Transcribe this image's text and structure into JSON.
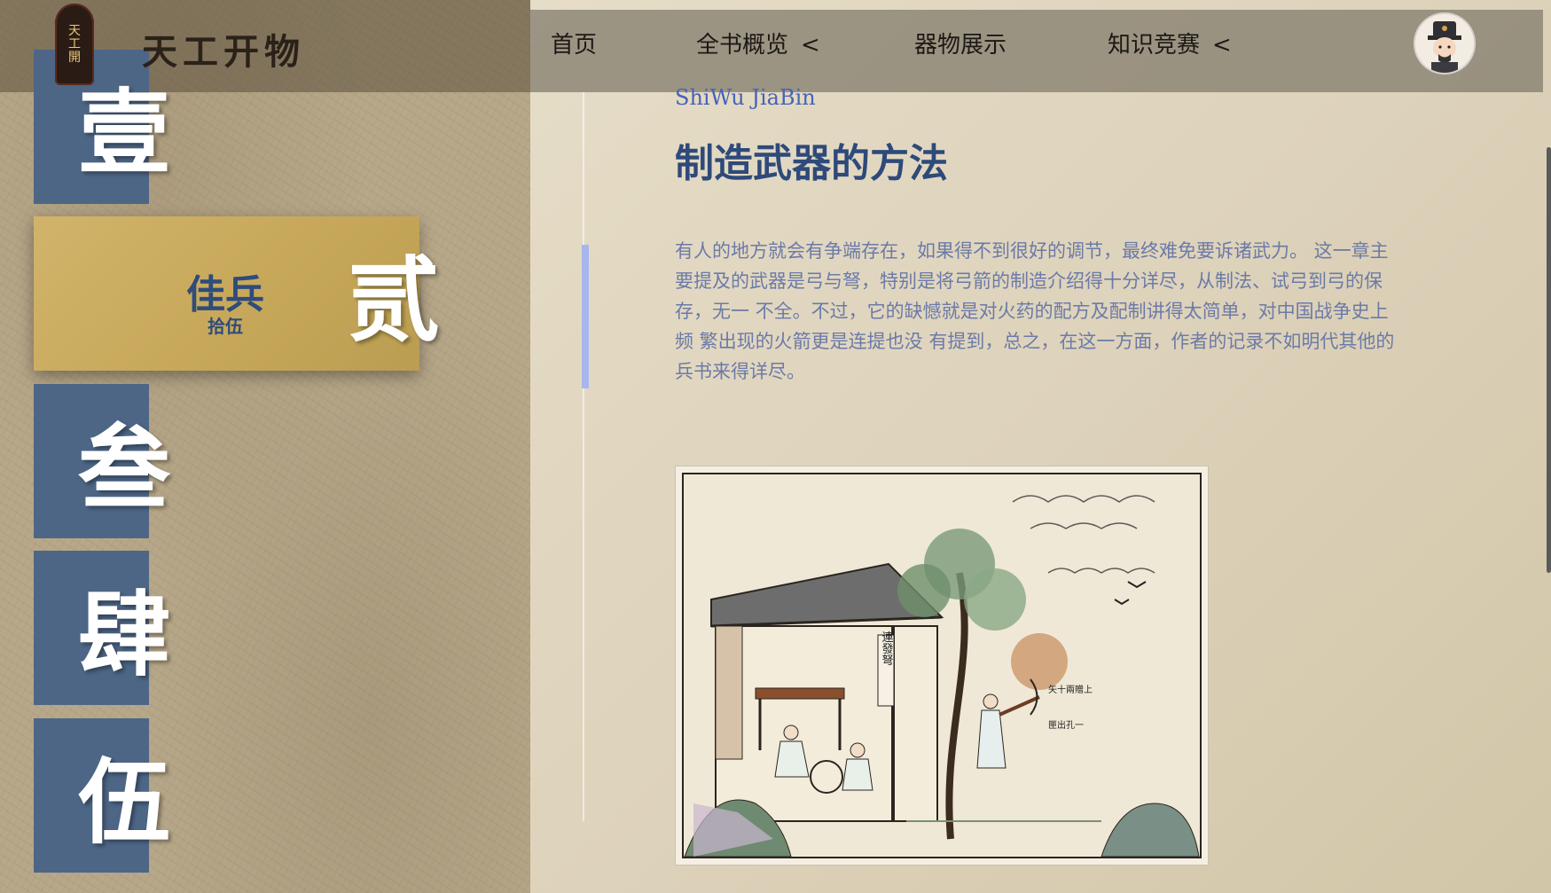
{
  "site": {
    "title": "天工开物",
    "seal_lines": [
      "天",
      "工",
      "開"
    ]
  },
  "nav": {
    "items": [
      {
        "label": "首页",
        "chevron": ""
      },
      {
        "label": "全书概览",
        "chevron": "<"
      },
      {
        "label": "器物展示",
        "chevron": ""
      },
      {
        "label": "知识竞赛",
        "chevron": "<"
      }
    ]
  },
  "avatar": {
    "icon": "scholar-avatar-icon"
  },
  "chapters": {
    "items": [
      {
        "char": "壹"
      },
      {
        "char": "贰"
      },
      {
        "char": "叁"
      },
      {
        "char": "肆"
      },
      {
        "char": "伍"
      }
    ],
    "active": {
      "title": "佳兵",
      "sub": "拾伍"
    }
  },
  "content": {
    "subtitle_en": "ShiWu JiaBin",
    "title": "制造武器的方法",
    "paragraph": "有人的地方就会有争端存在，如果得不到很好的调节，最终难免要诉诸武力。 这一章主要提及的武器是弓与弩，特别是将弓箭的制造介绍得十分详尽，从制法、试弓到弓的保存，无一 不全。不过，它的缺憾就是对火药的配方及配制讲得太简单，对中国战争史上频 繁出现的火箭更是连提也没 有提到，总之，在这一方面，作者的记录不如明代其他的兵书来得详尽。",
    "illustration": {
      "sign_text": "連發弩",
      "label_a": "矢十兩贈上",
      "label_b": "匣出孔一"
    }
  },
  "colors": {
    "tile_blue": "#4d6686",
    "active_gold": "#c6a759",
    "title_blue": "#2e4a7a",
    "accent_lavender": "#a8b6ee"
  }
}
